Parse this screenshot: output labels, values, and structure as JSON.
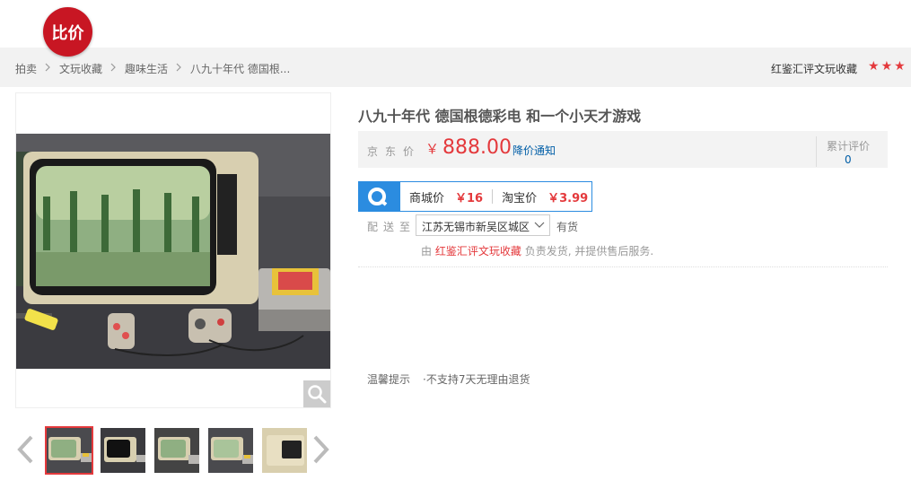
{
  "logo": {
    "text": "比价"
  },
  "breadcrumbs": [
    "拍卖",
    "文玩收藏",
    "趣味生活",
    "八九十年代 德国根..."
  ],
  "shop": {
    "name": "红鉴汇评文玩收藏",
    "rating_stars": 3
  },
  "product": {
    "title": "八九十年代 德国根德彩电 和一个小天才游戏",
    "price_label": "京东价",
    "currency": "￥",
    "price": "888.00",
    "price_notify": "降价通知",
    "review_label": "累计评价",
    "review_count": "0"
  },
  "compare": {
    "mall_label": "商城价",
    "mall_price": "￥16",
    "taobao_label": "淘宝价",
    "taobao_price": "￥3.99"
  },
  "shipping": {
    "label": "配送至",
    "location": "江苏无锡市新吴区城区",
    "stock": "有货",
    "fulfill_prefix": "由",
    "fulfill_seller": "红鉴汇评文玩收藏",
    "fulfill_suffix": "负责发货, 并提供售后服务."
  },
  "tips": {
    "label": "温馨提示",
    "text": "·不支持7天无理由退货"
  },
  "gallery": {
    "thumb_count": 5,
    "active_index": 0
  },
  "colors": {
    "accent": "#e4393c",
    "link": "#005ea7",
    "compare_blue": "#2b8ce0",
    "logo_red": "#c81623"
  }
}
